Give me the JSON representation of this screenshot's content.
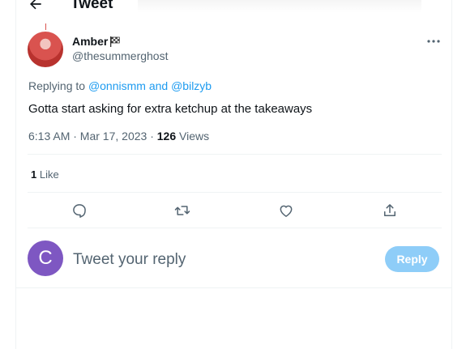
{
  "header": {
    "title": "Tweet"
  },
  "tweet": {
    "author_name": "Amber",
    "author_handle": "@thesummerghost",
    "replying_prefix": "Replying to",
    "replying_mentions": "@onnismm and @bilzyb",
    "text": "Gotta start asking for extra ketchup at the takeaways",
    "timestamp": "6:13 AM · Mar 17, 2023 · ",
    "views_count": "126",
    "views_label": "Views",
    "likes_count": "1",
    "likes_label": "Like"
  },
  "reply_box": {
    "avatar_letter": "C",
    "placeholder": "Tweet your reply",
    "button_label": "Reply"
  },
  "icons": {
    "back": "arrow-left-icon",
    "flag": "checkered-flag-icon",
    "more": "more-horizontal-icon",
    "reply": "comment-icon",
    "retweet": "retweet-icon",
    "like": "heart-icon",
    "share": "share-icon"
  },
  "colors": {
    "accent": "#1d9bf0",
    "reply_button": "#8ecdf8",
    "avatar_purple": "#7e57c2",
    "secondary_text": "#536471"
  }
}
